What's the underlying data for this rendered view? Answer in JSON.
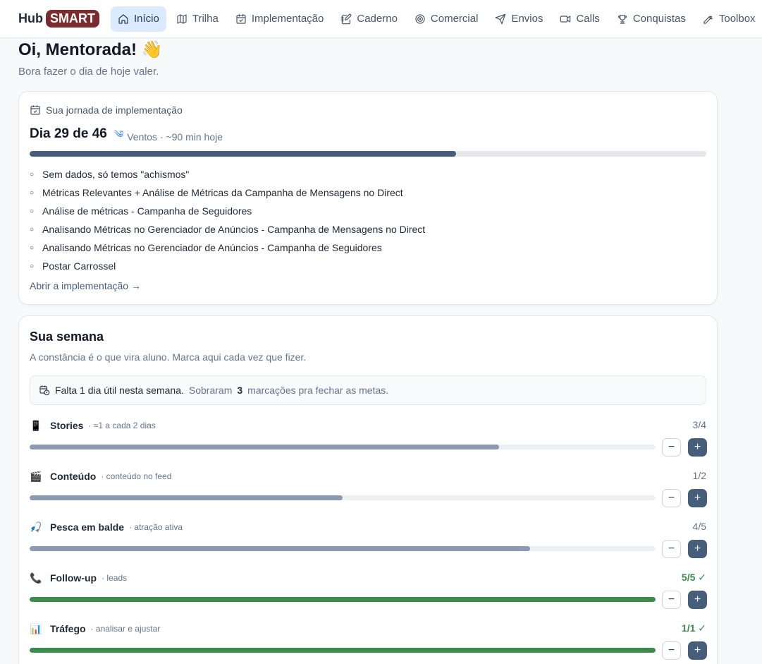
{
  "brand": {
    "hub": "Hub",
    "smart": "SMART"
  },
  "nav": [
    {
      "label": "Início",
      "icon": "home-icon",
      "active": true
    },
    {
      "label": "Trilha",
      "icon": "map-icon"
    },
    {
      "label": "Implementação",
      "icon": "calendar-check-icon"
    },
    {
      "label": "Caderno",
      "icon": "notebook-pen-icon"
    },
    {
      "label": "Comercial",
      "icon": "target-icon"
    },
    {
      "label": "Envios",
      "icon": "send-icon"
    },
    {
      "label": "Calls",
      "icon": "video-icon"
    },
    {
      "label": "Conquistas",
      "icon": "trophy-icon"
    },
    {
      "label": "Toolbox",
      "icon": "wrench-icon"
    }
  ],
  "greeting": {
    "title": "Oi, Mentorada! 👋",
    "subtitle": "Bora fazer o dia de hoje valer."
  },
  "journey": {
    "label": "Sua jornada de implementação",
    "day_title": "Dia 29 de 46",
    "meta": "Ventos · ~90 min hoje",
    "progress": 0.63,
    "tasks": [
      "Sem dados, só temos \"achismos\"",
      "Métricas Relevantes + Análise de Métricas da Campanha de Mensagens no Direct",
      "Análise de métricas - Campanha de Seguidores",
      "Analisando Métricas no Gerenciador de Anúncios - Campanha de Mensagens no Direct",
      "Analisando Métricas no Gerenciador de Anúncios - Campanha de Seguidores",
      "Postar Carrossel"
    ],
    "link": "Abrir a implementação →"
  },
  "week": {
    "title": "Sua semana",
    "subtitle": "A constância é o que vira aluno. Marca aqui cada vez que fizer.",
    "notice_strong": "Falta 1 dia útil nesta semana.",
    "notice_pre": "Sobraram",
    "notice_num": "3",
    "notice_post": "marcações pra fechar as metas.",
    "habits": [
      {
        "emoji": "📱",
        "name": "Stories",
        "hint": "· ≈1 a cada 2 dias",
        "count": "3/4",
        "done": 3,
        "goal": 4
      },
      {
        "emoji": "🎬",
        "name": "Conteúdo",
        "hint": "· conteúdo no feed",
        "count": "1/2",
        "done": 1,
        "goal": 2
      },
      {
        "emoji": "🎣",
        "name": "Pesca em balde",
        "hint": "· atração ativa",
        "count": "4/5",
        "done": 4,
        "goal": 5
      },
      {
        "emoji": "📞",
        "name": "Follow-up",
        "hint": "· leads",
        "count": "5/5 ✓",
        "done": 5,
        "goal": 5
      },
      {
        "emoji": "📊",
        "name": "Tráfego",
        "hint": "· analisar e ajustar",
        "count": "1/1 ✓",
        "done": 1,
        "goal": 1
      }
    ]
  },
  "colors": {
    "brand_accent": "#7a2b2b",
    "nav_active_bg": "#dbeafe",
    "primary": "#475e7a",
    "success": "#3d8a4c"
  }
}
